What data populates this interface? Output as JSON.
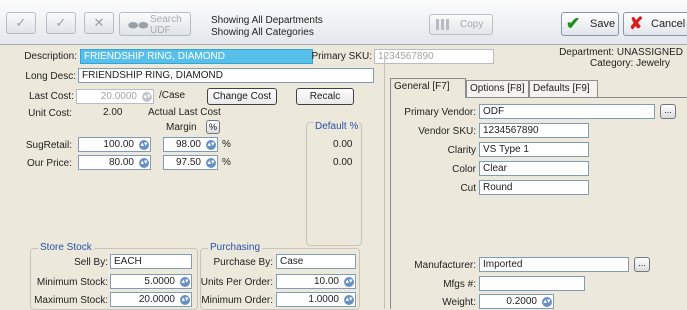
{
  "toolbar": {
    "search_label": "Search UDF",
    "status_departments": "Showing All Departments",
    "status_categories": "Showing All Categories",
    "copy_label": "Copy",
    "save_label": "Save",
    "cancel_label": "Cancel"
  },
  "header": {
    "description_label": "Description:",
    "description_value": "FRIENDSHIP RING, DIAMOND",
    "primary_sku_label": "Primary SKU:",
    "primary_sku_value": "1234567890",
    "department_text": "Department: UNASSIGNED",
    "category_text": "Category: Jewelry",
    "long_desc_label": "Long Desc:",
    "long_desc_value": "FRIENDSHIP RING, DIAMOND"
  },
  "cost": {
    "last_cost_label": "Last Cost:",
    "last_cost_value": "20.0000",
    "per_case_label": "/Case",
    "change_cost_label": "Change Cost",
    "recalc_label": "Recalc",
    "unit_cost_label": "Unit Cost:",
    "unit_cost_value": "2.00",
    "actual_last_cost_label": "Actual Last Cost",
    "margin_label": "Margin",
    "margin_toggle": "%",
    "default_pct_label": "Default %",
    "sug_retail_label": "SugRetail:",
    "sug_retail_value": "100.00",
    "sug_retail_margin": "98.00",
    "sug_retail_pct_sign": "%",
    "sug_retail_default": "0.00",
    "our_price_label": "Our Price:",
    "our_price_value": "80.00",
    "our_price_margin": "97.50",
    "our_price_pct_sign": "%",
    "our_price_default": "0.00"
  },
  "store_stock": {
    "title": "Store Stock",
    "sell_by_label": "Sell By:",
    "sell_by_value": "EACH",
    "min_stock_label": "Minimum Stock:",
    "min_stock_value": "5.0000",
    "max_stock_label": "Maximum Stock:",
    "max_stock_value": "20.0000"
  },
  "purchasing": {
    "title": "Purchasing",
    "purchase_by_label": "Purchase By:",
    "purchase_by_value": "Case",
    "units_per_order_label": "Units Per Order:",
    "units_per_order_value": "10.00",
    "min_order_label": "Minimum Order:",
    "min_order_value": "1.0000"
  },
  "tabs": [
    "General [F7]",
    "Options [F8]",
    "Defaults [F9]"
  ],
  "general": {
    "primary_vendor_label": "Primary Vendor:",
    "primary_vendor_value": "ODF",
    "vendor_sku_label": "Vendor SKU:",
    "vendor_sku_value": "1234567890",
    "clarity_label": "Clarity",
    "clarity_value": "VS Type 1",
    "color_label": "Color",
    "color_value": "Clear",
    "cut_label": "Cut",
    "cut_value": "Round",
    "manufacturer_label": "Manufacturer:",
    "manufacturer_value": "Imported",
    "mfgs_label": "Mfgs #:",
    "mfgs_value": "",
    "weight_label": "Weight:",
    "weight_value": "0.2000",
    "browse_label": "..."
  },
  "icons": {
    "check": "check-icon",
    "x": "close-icon",
    "binoculars": "binoculars-icon",
    "spinner": "spinner-icon"
  }
}
